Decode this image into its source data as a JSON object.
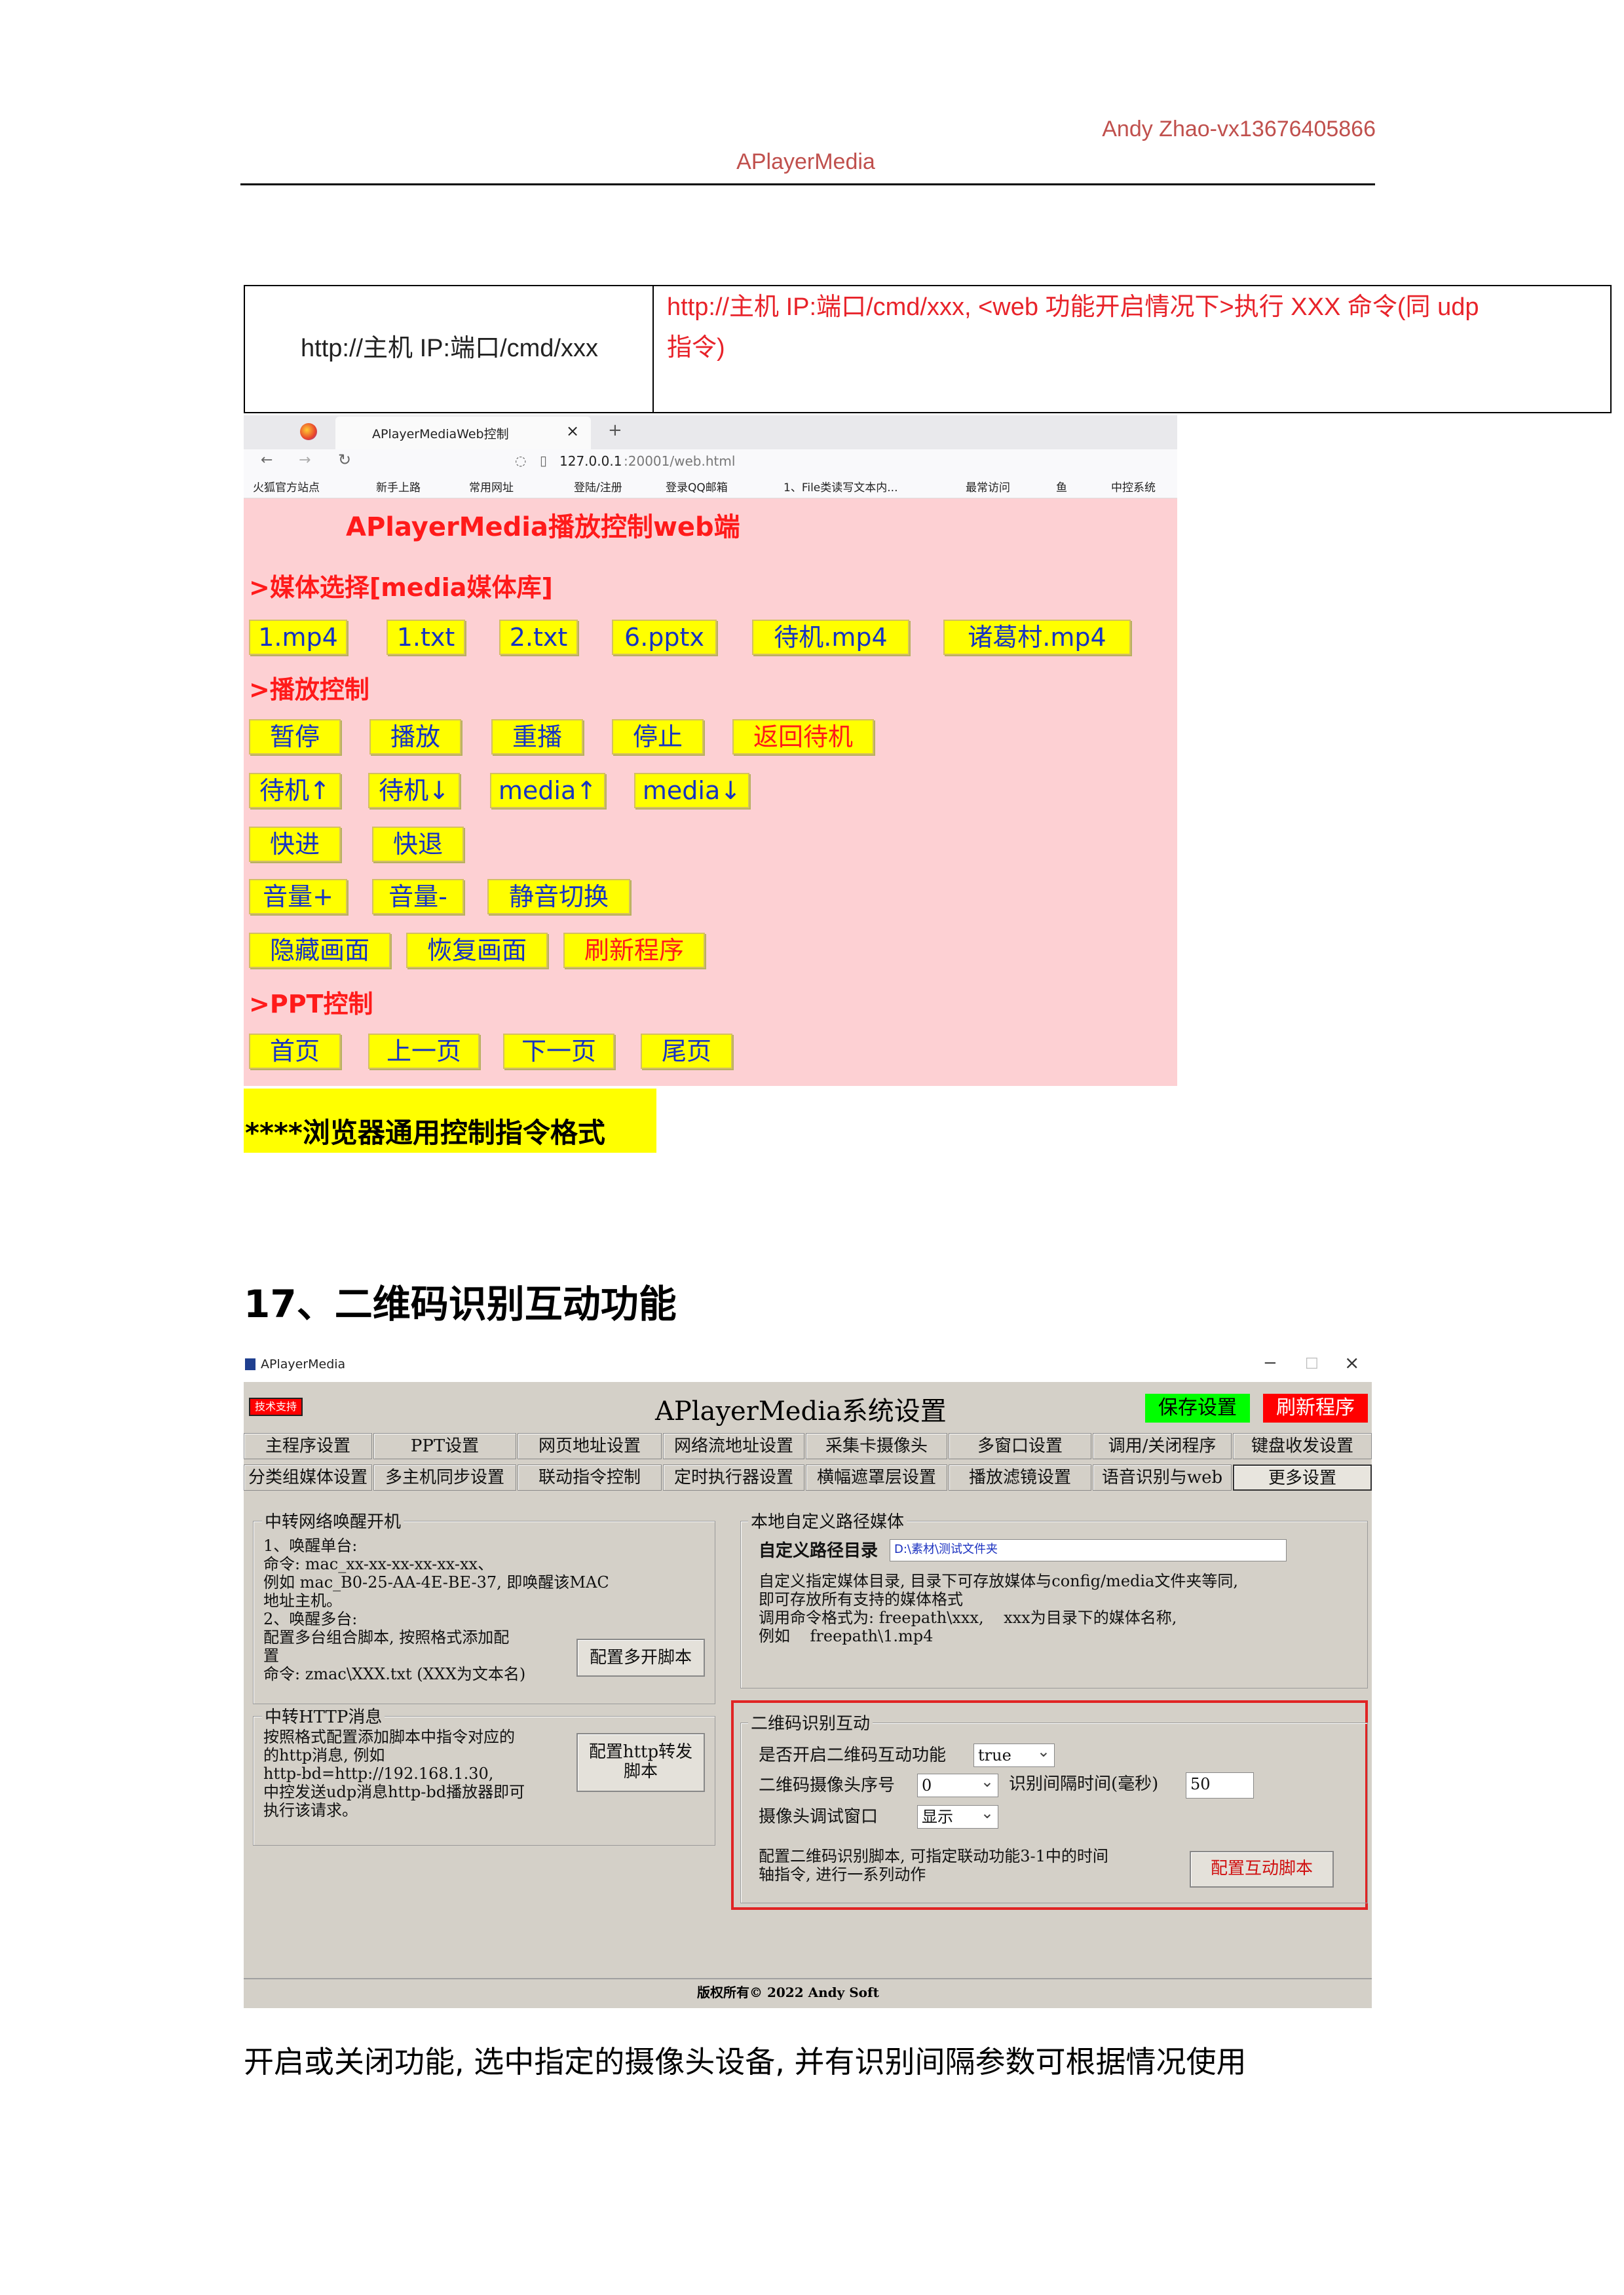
{
  "header": {
    "author": "Andy Zhao-vx13676405866",
    "doc_title": "APlayerMedia"
  },
  "table": {
    "col1": "http://主机 IP:端口/cmd/xxx",
    "col2_line1": "http://主机 IP:端口/cmd/xxx, <web 功能开启情况下>执行 XXX 命令(同 udp",
    "col2_line2": "指令)"
  },
  "browser": {
    "tab_title": "APlayerMediaWeb控制",
    "tab_close": "×",
    "new_tab": "+",
    "url_host": "127.0.0.1",
    "url_rest": ":20001/web.html",
    "bookmarks": [
      "火狐官方站点",
      "新手上路",
      "常用网址",
      "登陆/注册",
      "登录QQ邮箱",
      "1、File类读写文本内...",
      "最常访问",
      "鱼",
      "中控系统"
    ]
  },
  "web": {
    "title": "APlayerMedia播放控制web端",
    "media_heading": ">媒体选择[media媒体库]",
    "media_buttons": [
      "1.mp4",
      "1.txt",
      "2.txt",
      "6.pptx",
      "待机.mp4",
      "诸葛村.mp4"
    ],
    "play_heading": ">播放控制",
    "row1": [
      "暂停",
      "播放",
      "重播",
      "停止",
      "返回待机"
    ],
    "row2": [
      "待机↑",
      "待机↓",
      "media↑",
      "media↓"
    ],
    "row3": [
      "快进",
      "快退"
    ],
    "row4": [
      "音量+",
      "音量-",
      "静音切换"
    ],
    "row5": [
      "隐藏画面",
      "恢复画面",
      "刷新程序"
    ],
    "ppt_heading": ">PPT控制",
    "ppt_buttons": [
      "首页",
      "上一页",
      "下一页",
      "尾页"
    ]
  },
  "highlight": "****浏览器通用控制指令格式",
  "section_title": "17、二维码识别互动功能",
  "app": {
    "window_title": "APlayerMedia",
    "win_controls": [
      "−",
      "□",
      "×"
    ],
    "tech_badge": "技术支持",
    "main_title": "APlayerMedia系统设置",
    "save_btn": "保存设置",
    "refresh_btn": "刷新程序",
    "tabs_row1": [
      "主程序设置",
      "PPT设置",
      "网页地址设置",
      "网络流地址设置",
      "采集卡摄像头",
      "多窗口设置",
      "调用/关闭程序",
      "键盘收发设置"
    ],
    "tabs_row2": [
      "分类组媒体设置",
      "多主机同步设置",
      "联动指令控制",
      "定时执行器设置",
      "横幅遮罩层设置",
      "播放滤镜设置",
      "语音识别与web",
      "更多设置"
    ],
    "wol": {
      "title": "中转网络唤醒开机",
      "text": "1、唤醒单台:\n命令: mac_xx-xx-xx-xx-xx-xx、\n例如 mac_B0-25-AA-4E-BE-37, 即唤醒该MAC\n地址主机。\n2、唤醒多台:\n配置多台组合脚本, 按照格式添加配\n置\n命令: zmac\\XXX.txt (XXX为文本名)",
      "button": "配置多开脚本"
    },
    "http": {
      "title": "中转HTTP消息",
      "text": "按照格式配置添加脚本中指令对应的\n的http消息, 例如\nhttp-bd=http://192.168.1.30,\n中控发送udp消息http-bd播放器即可\n执行该请求。",
      "button_l1": "配置http转发",
      "button_l2": "脚本"
    },
    "path": {
      "title": "本地自定义路径媒体",
      "label": "自定义路径目录",
      "value": "D:\\素材\\测试文件夹",
      "text": "自定义指定媒体目录, 目录下可存放媒体与config/media文件夹等同,\n即可存放所有支持的媒体格式\n调用命令格式为: freepath\\xxx,    xxx为目录下的媒体名称,\n例如    freepath\\1.mp4"
    },
    "qr": {
      "title": "二维码识别互动",
      "enable_label": "是否开启二维码互动功能",
      "enable_value": "true",
      "camera_label": "二维码摄像头序号",
      "camera_value": "0",
      "interval_label": "识别间隔时间(毫秒)",
      "interval_value": "50",
      "debug_label": "摄像头调试窗口",
      "debug_value": "显示",
      "script_text": "配置二维码识别脚本, 可指定联动功能3-1中的时间\n轴指令, 进行一系列动作",
      "script_button": "配置互动脚本"
    },
    "copyright": "版权所有© 2022  Andy Soft"
  },
  "bottom_text": "开启或关闭功能, 选中指定的摄像头设备, 并有识别间隔参数可根据情况使用",
  "colors": {
    "header_accent": "#c0504d",
    "table_red": "#e8232a",
    "web_bg": "#fdd0d3",
    "web_button": "#ffff00",
    "app_bg": "#d4d0c8",
    "save_green": "#00ff00",
    "refresh_red": "#ff0000",
    "qr_border": "#e02424"
  }
}
